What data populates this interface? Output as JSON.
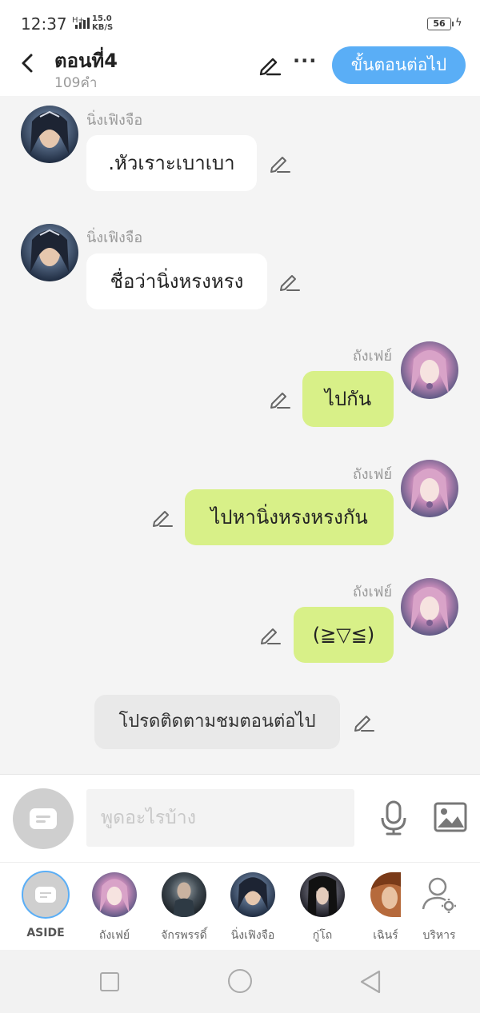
{
  "status_bar": {
    "time": "12:37",
    "network": "H+",
    "speed_value": "15.0",
    "speed_unit": "KB/S",
    "battery": "56"
  },
  "header": {
    "title": "ตอนที่4",
    "word_count": "109คำ",
    "next_button": "ขั้นตอนต่อไป",
    "more_label": "···"
  },
  "messages": [
    {
      "side": "left",
      "sender": "นิ่งเฟิงจือ",
      "text": ".หัวเราะเบาเบา"
    },
    {
      "side": "left",
      "sender": "นิ่งเฟิงจือ",
      "text": "ชื่อว่านิ่งหรงหรง"
    },
    {
      "side": "right",
      "sender": "ถังเฟย์",
      "text": "ไปกัน"
    },
    {
      "side": "right",
      "sender": "ถังเฟย์",
      "text": "ไปหานิ่งหรงหรงกัน"
    },
    {
      "side": "right",
      "sender": "ถังเฟย์",
      "text": "(≧▽≦)"
    },
    {
      "side": "center",
      "sender": "",
      "text": "โปรดติดตามชมตอนต่อไป"
    }
  ],
  "input": {
    "placeholder": "พูดอะไรบ้าง"
  },
  "characters": [
    {
      "label": "ASIDE"
    },
    {
      "label": "ถังเฟย์"
    },
    {
      "label": "จักรพรรดิ์"
    },
    {
      "label": "นิ่งเฟิงจือ"
    },
    {
      "label": "กู่โถ"
    },
    {
      "label": "เฉินร์"
    },
    {
      "label": "บริหาร"
    }
  ],
  "colors": {
    "accent": "#5aaef6",
    "right_bubble": "#d8f088",
    "left_bubble": "#ffffff",
    "narration_bubble": "#e9e9e9",
    "background": "#f4f4f4"
  },
  "icons": [
    "back-icon",
    "pencil-icon",
    "more-icon",
    "mic-icon",
    "image-icon",
    "manage-user-icon",
    "aside-chat-icon"
  ]
}
